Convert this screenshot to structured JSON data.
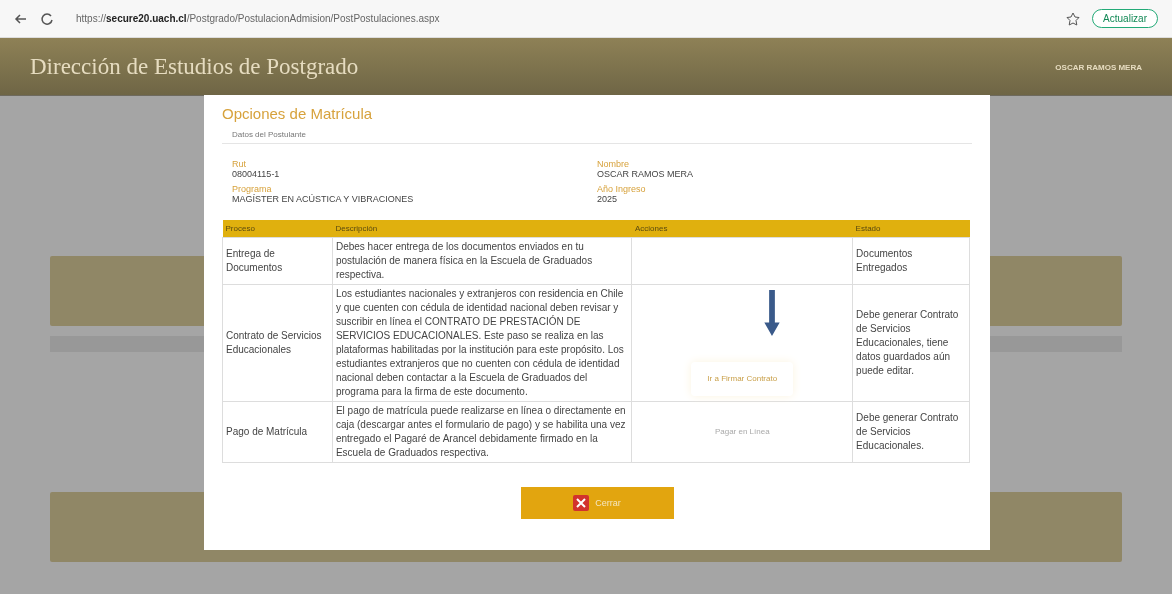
{
  "browser": {
    "url_scheme": "https://",
    "url_host": "secure20.uach.cl",
    "url_path": "/Postgrado/PostulacionAdmision/PostPostulaciones.aspx",
    "update_button": "Actualizar"
  },
  "header": {
    "title": "Dirección de Estudios de Postgrado",
    "user": "OSCAR RAMOS MERA"
  },
  "modal": {
    "title": "Opciones de Matrícula",
    "section": "Datos del Postulante",
    "fields": [
      {
        "label": "Rut",
        "value": "08004115-1"
      },
      {
        "label": "Nombre",
        "value": "OSCAR RAMOS MERA"
      },
      {
        "label": "Programa",
        "value": "MAGÍSTER EN ACÚSTICA Y VIBRACIONES"
      },
      {
        "label": "Año Ingreso",
        "value": "2025"
      }
    ],
    "table": {
      "columns": [
        "Proceso",
        "Descripción",
        "Acciones",
        "Estado"
      ],
      "rows": [
        {
          "process": "Entrega de Documentos",
          "description": "Debes hacer entrega de los documentos enviados en tu postulación de manera física en la Escuela de Graduados respectiva.",
          "status": "Documentos Entregados"
        },
        {
          "process": "Contrato de Servicios Educacionales",
          "description": "Los estudiantes nacionales y extranjeros con residencia en Chile y que cuenten con cédula de identidad nacional deben revisar y suscribir en línea el CONTRATO DE PRESTACIÓN DE SERVICIOS EDUCACIONALES. Este paso se realiza en las plataformas habilitadas por la institución para este propósito. Los estudiantes extranjeros que no cuenten con cédula de identidad nacional deben contactar a la Escuela de Graduados del programa para la firma de este documento.",
          "action": {
            "label": "Ir a Firmar Contrato",
            "disabled": false
          },
          "status": "Debe generar Contrato de Servicios Educacionales, tiene datos guardados aún puede editar."
        },
        {
          "process": "Pago de Matrícula",
          "description": "El pago de matrícula puede realizarse en línea o directamente en caja (descargar antes el formulario de pago) y se habilita una vez entregado el Pagaré de Arancel debidamente firmado en la Escuela de Graduados respectiva.",
          "action": {
            "label": "Pagar en Línea",
            "disabled": true
          },
          "status": "Debe generar Contrato de Servicios Educacionales."
        }
      ]
    },
    "close_button": "Cerrar"
  }
}
